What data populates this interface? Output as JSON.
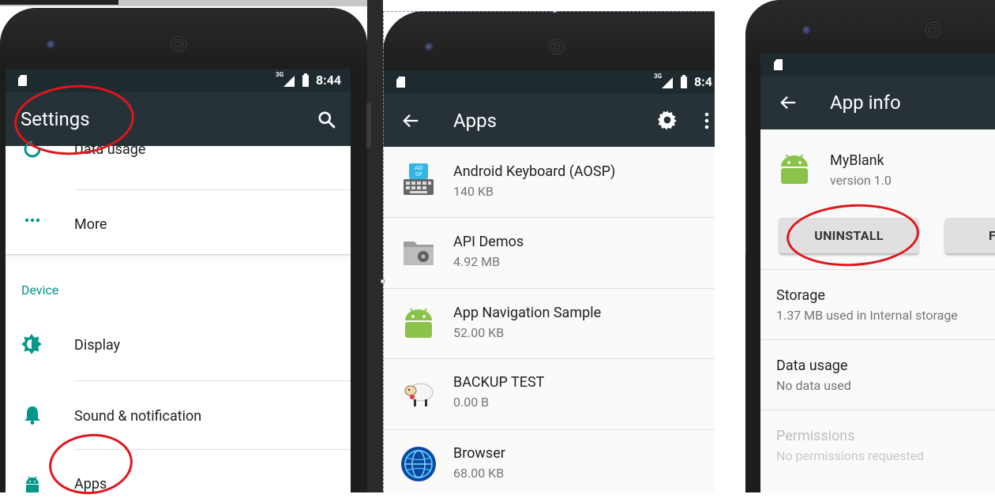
{
  "colors": {
    "accent": "#009688",
    "toolbar": "#263238",
    "statusbar": "#1f2a2f",
    "annotation": "#e0161d"
  },
  "status": {
    "clock": "8:44",
    "clock_partial": "8:4",
    "network": "3G"
  },
  "settings": {
    "title": "Settings",
    "items_top": [
      {
        "label": "Data usage",
        "icon": "data-usage-icon"
      },
      {
        "label": "More",
        "icon": "more-dots-icon"
      }
    ],
    "section_header": "Device",
    "items_device": [
      {
        "label": "Display",
        "icon": "brightness-icon"
      },
      {
        "label": "Sound & notification",
        "icon": "bell-icon"
      },
      {
        "label": "Apps",
        "icon": "android-icon"
      }
    ]
  },
  "apps": {
    "title": "Apps",
    "list": [
      {
        "name": "Android Keyboard (AOSP)",
        "size": "140 KB",
        "icon": "keyboard-app-icon"
      },
      {
        "name": "API Demos",
        "size": "4.92 MB",
        "icon": "folder-gear-app-icon"
      },
      {
        "name": "App Navigation Sample",
        "size": "52.00 KB",
        "icon": "android-app-icon"
      },
      {
        "name": "BACKUP TEST",
        "size": "0.00 B",
        "icon": "sheep-app-icon"
      },
      {
        "name": "Browser",
        "size": "68.00 KB",
        "icon": "globe-app-icon"
      }
    ]
  },
  "app_info": {
    "title": "App info",
    "app_name": "MyBlank",
    "version": "version 1.0",
    "uninstall_label": "UNINSTALL",
    "force_stop_partial": "FO",
    "rows": [
      {
        "title": "Storage",
        "subtitle": "1.37 MB used in Internal storage",
        "disabled": false
      },
      {
        "title": "Data usage",
        "subtitle": "No data used",
        "disabled": false
      },
      {
        "title": "Permissions",
        "subtitle": "No permissions requested",
        "disabled": true
      }
    ]
  }
}
